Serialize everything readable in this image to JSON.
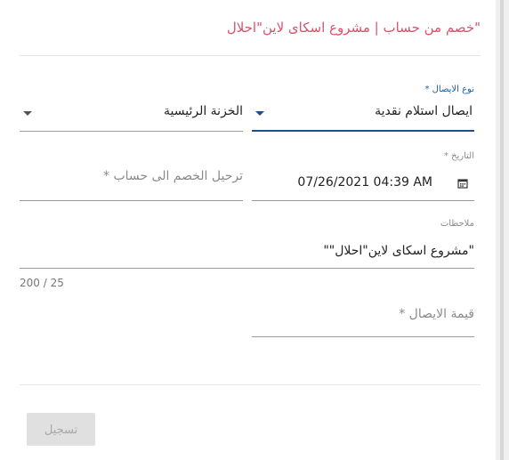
{
  "dialog": {
    "title": "\"خصم من حساب | مشروع اسكاى لاين\"احلال"
  },
  "receipt_type": {
    "label": "نوع الايصال *",
    "value": "ايصال استلام نقدية"
  },
  "treasury": {
    "value": "الخزنة الرئيسية"
  },
  "date": {
    "label": "التاريخ *",
    "value": "07/26/2021 04:39 AM",
    "icon": "calendar-icon"
  },
  "transfer_account": {
    "placeholder": "ترحيل الخصم الى حساب *"
  },
  "notes": {
    "label": "ملاحظات",
    "value": "\"مشروع اسكاى لاين\"احلال\"\"",
    "counter": "200 / 25"
  },
  "receipt_value": {
    "placeholder": "قيمة الايصال *"
  },
  "actions": {
    "submit_label": "تسجيل"
  }
}
